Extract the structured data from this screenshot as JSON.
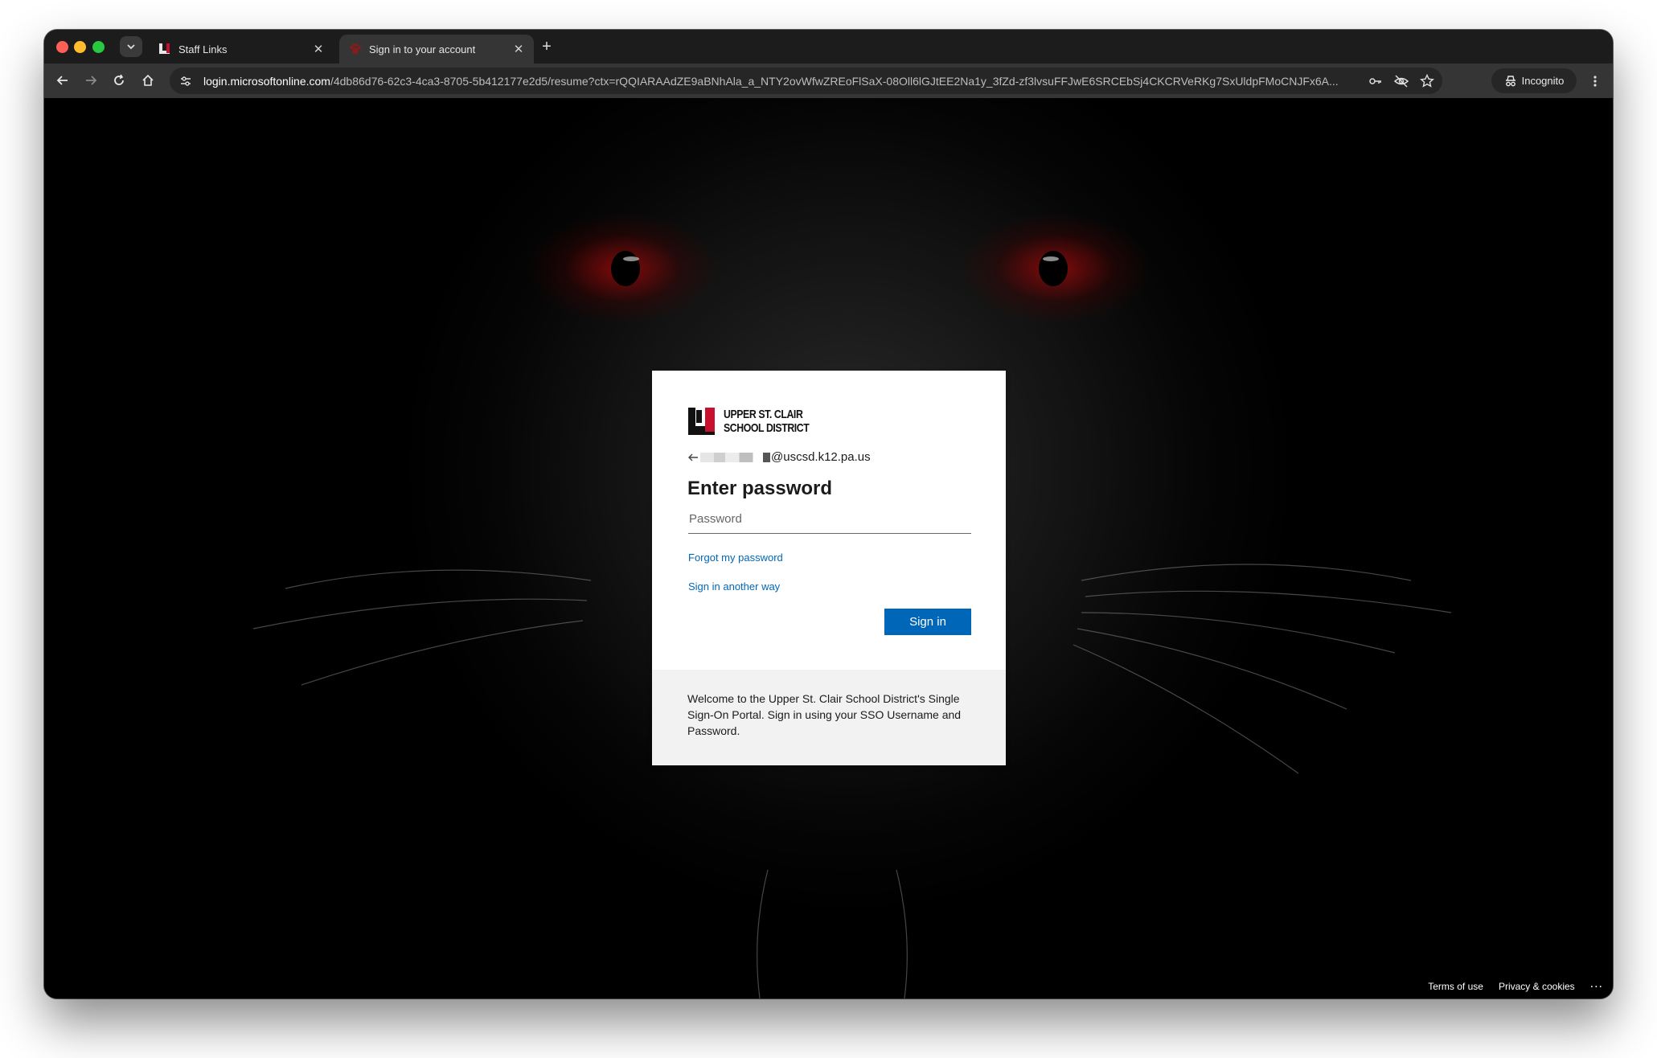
{
  "browser": {
    "tabs": [
      {
        "title": "Staff Links",
        "active": false,
        "favicon": "uscsd-logo-icon"
      },
      {
        "title": "Sign in to your account",
        "active": true,
        "favicon": "paw-icon"
      }
    ],
    "url_host": "login.microsoftonline.com",
    "url_rest": "/4db86d76-62c3-4ca3-8705-5b412177e2d5/resume?ctx=rQQIARAAdZE9aBNhAla_a_NTY2ovWfwZREoFlSaX-08Oll6lGJtEE2Na1y_3fZd-zf3lvsuFFJwE6SRCEbSj4CKCRVeRKg7SxUldpFMoCNJFx6A...",
    "incognito_label": "Incognito"
  },
  "signin": {
    "org_name_line1": "UPPER ST. CLAIR",
    "org_name_line2": "SCHOOL DISTRICT",
    "identity_suffix": "@uscsd.k12.pa.us",
    "heading": "Enter password",
    "password_placeholder": "Password",
    "forgot_link": "Forgot my password",
    "other_way_link": "Sign in another way",
    "signin_button": "Sign in",
    "footer_message": "Welcome to the Upper St. Clair School District's Single Sign-On Portal. Sign in using your SSO Username and Password."
  },
  "page_footer": {
    "terms": "Terms of use",
    "privacy": "Privacy & cookies",
    "more": "..."
  },
  "colors": {
    "accent": "#0067b8",
    "brand_red": "#c8102e",
    "footer_bg": "#f2f2f2"
  }
}
